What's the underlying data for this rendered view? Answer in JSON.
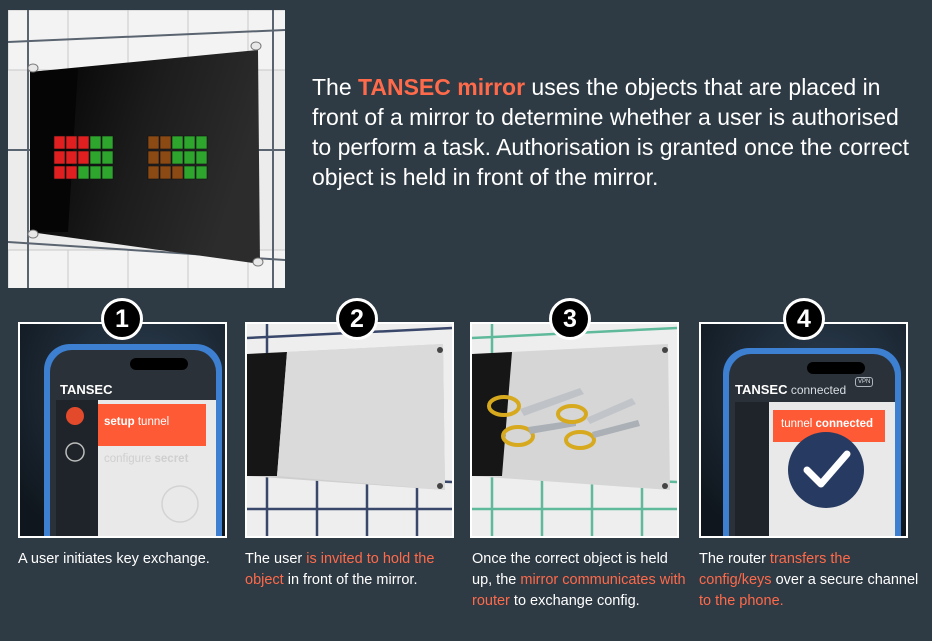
{
  "intro": {
    "p1": "The ",
    "brand": "TANSEC mirror",
    "p2": " uses the objects that are  placed in front of a mirror to determine whether a user is authorised to perform a task.  Authorisation is granted once the correct object is held in front of the mirror."
  },
  "steps": [
    {
      "number": "1",
      "phone": {
        "title": "TANSEC",
        "item1_a": "setup",
        "item1_b": " tunnel",
        "item2_a": "configure ",
        "item2_b": "secret"
      },
      "caption": {
        "text": "A user initiates key exchange."
      }
    },
    {
      "number": "2",
      "caption": {
        "a": "The user ",
        "b": "is invited to hold the object",
        "c": " in front of the mirror."
      }
    },
    {
      "number": "3",
      "caption": {
        "a": "Once the correct object is held up, the ",
        "b": "mirror communicates with router",
        "c": " to exchange config."
      }
    },
    {
      "number": "4",
      "phone": {
        "title_a": "TANSEC",
        "title_b": " connected",
        "vpn": "VPN",
        "banner_a": "tunnel ",
        "banner_b": "connected"
      },
      "caption": {
        "a": "The router ",
        "b": "transfers the config/keys",
        "c": " over a secure channel ",
        "d": "to the phone."
      }
    }
  ],
  "colors": {
    "background": "#2e3a44",
    "accent": "#ff6a4a",
    "tile_red": "#e02020",
    "tile_green": "#2ea62e",
    "tile_brown": "#8b4a14"
  }
}
